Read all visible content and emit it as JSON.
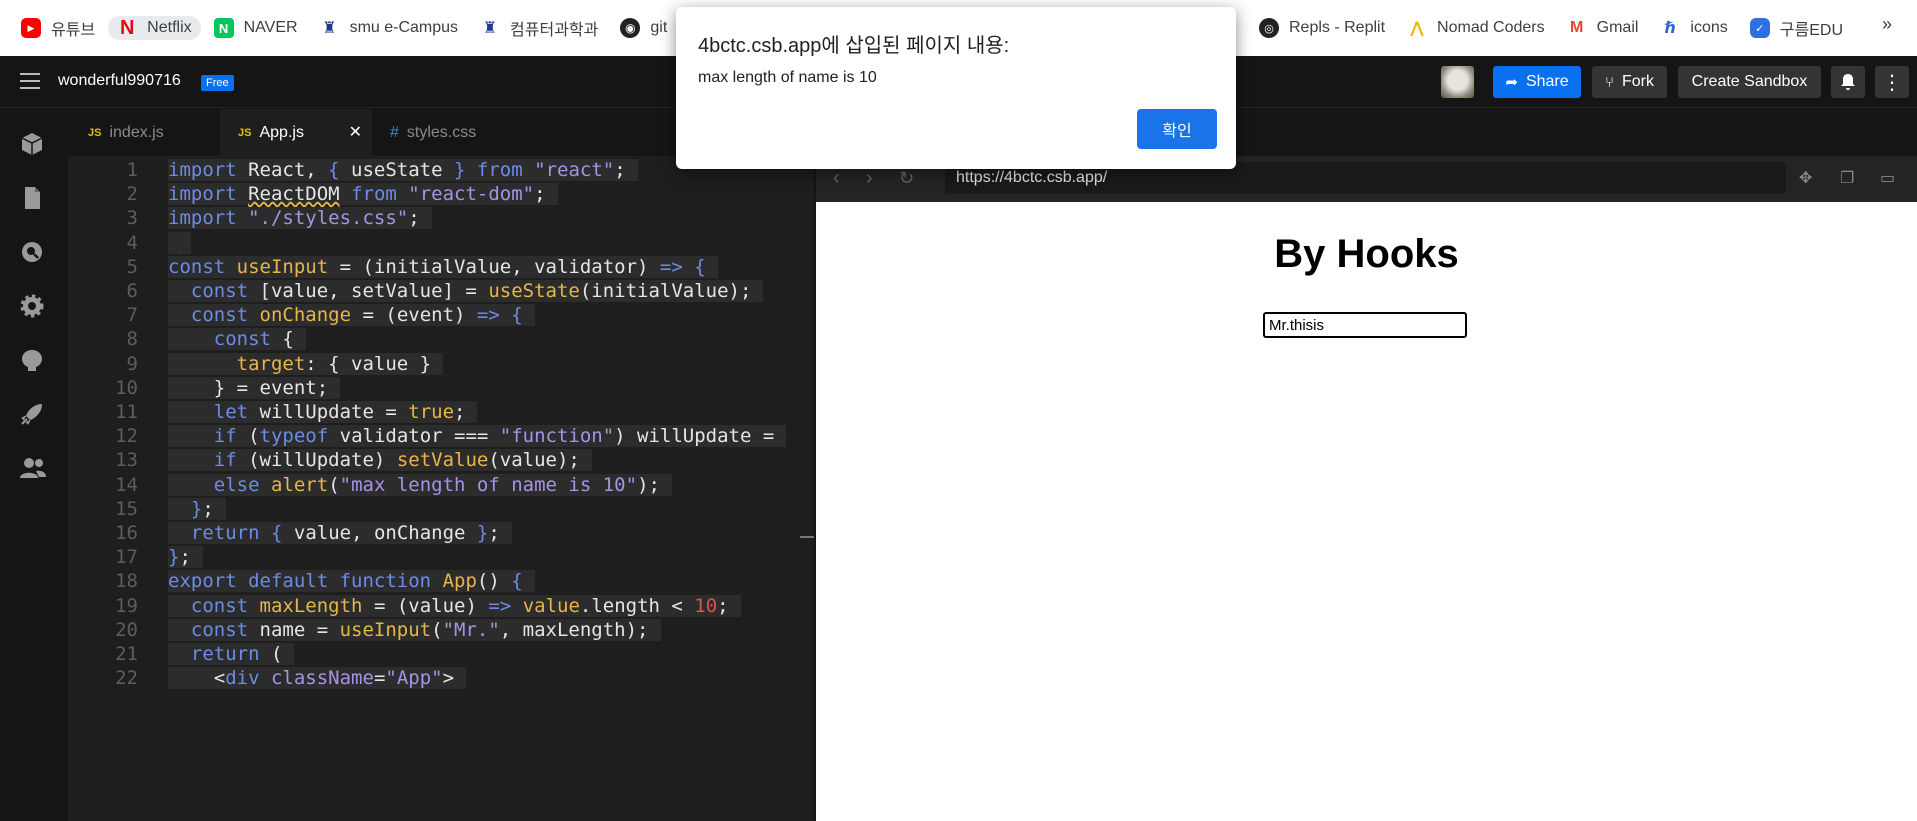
{
  "bookmarks": {
    "left": [
      {
        "label": "유튜브",
        "icon": "youtube-icon"
      },
      {
        "label": "Netflix",
        "icon": "netflix-icon"
      },
      {
        "label": "NAVER",
        "icon": "naver-icon"
      },
      {
        "label": "smu e-Campus",
        "icon": "smu-icon"
      },
      {
        "label": "컴퓨터과학과",
        "icon": "smu-icon"
      },
      {
        "label": "git",
        "icon": "github-icon"
      }
    ],
    "right": [
      {
        "label": "Repls - Replit",
        "icon": "replit-icon"
      },
      {
        "label": "Nomad Coders",
        "icon": "nomad-icon"
      },
      {
        "label": "Gmail",
        "icon": "gmail-icon"
      },
      {
        "label": "icons",
        "icon": "icons-icon"
      },
      {
        "label": "구름EDU",
        "icon": "goorm-icon"
      }
    ],
    "more": "»"
  },
  "header": {
    "sandbox_name": "wonderful990716",
    "plan_badge": "Free",
    "share_label": "Share",
    "fork_label": "Fork",
    "create_label": "Create Sandbox"
  },
  "tabs": [
    {
      "label": "index.js",
      "type": "JS"
    },
    {
      "label": "App.js",
      "type": "JS"
    },
    {
      "label": "styles.css",
      "type": "#"
    }
  ],
  "editor": {
    "line_numbers": [
      "1",
      "2",
      "3",
      "4",
      "5",
      "6",
      "7",
      "8",
      "9",
      "10",
      "11",
      "12",
      "13",
      "14",
      "15",
      "16",
      "17",
      "18",
      "19",
      "20",
      "21",
      "22"
    ]
  },
  "preview": {
    "url": "https://4bctc.csb.app/",
    "heading": "By Hooks",
    "input_value": "Mr.thisis"
  },
  "dialog": {
    "title": "4bctc.csb.app에 삽입된 페이지 내용:",
    "message": "max length of name is 10",
    "ok_label": "확인"
  },
  "colors": {
    "accent": "#0971f1",
    "dialog_button": "#1a73e8",
    "editor_bg": "#1e1e1e",
    "keyword": "#6c8ce8",
    "string": "#a693e6",
    "function": "#e8b54a"
  }
}
